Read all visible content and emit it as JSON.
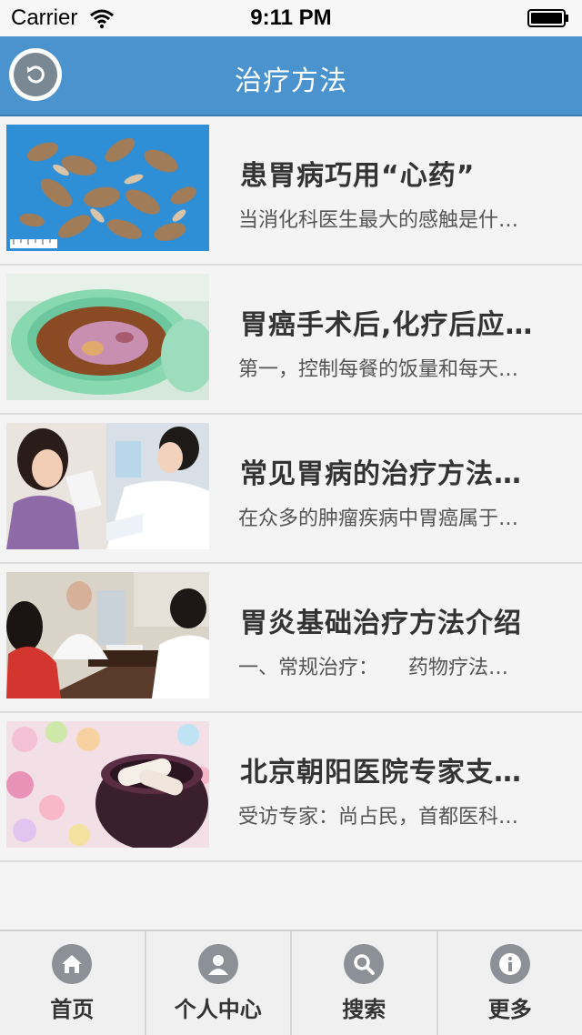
{
  "status_bar": {
    "carrier": "Carrier",
    "time": "9:11 PM"
  },
  "nav": {
    "title": "治疗方法",
    "accent_color": "#4a93cf"
  },
  "articles": [
    {
      "title": "患胃病巧用“心药”",
      "desc": "当消化科医生最大的感触是什…",
      "image": "dried-herbs-image"
    },
    {
      "title": "胃癌手术后,化疗后应…",
      "desc": "第一，控制每餐的饭量和每天…",
      "image": "tea-cup-image"
    },
    {
      "title": "常见胃病的治疗方法…",
      "desc": "在众多的肿瘤疾病中胃癌属于…",
      "image": "doctor-patient-image"
    },
    {
      "title": "胃炎基础治疗方法介绍",
      "desc": "一、常规治疗：　　药物疗法…",
      "image": "consultation-image"
    },
    {
      "title": "北京朝阳医院专家支…",
      "desc": "受访专家：尚占民，首都医科…",
      "image": "pills-jar-image"
    }
  ],
  "tabs": [
    {
      "label": "首页",
      "icon": "home-icon"
    },
    {
      "label": "个人中心",
      "icon": "user-icon"
    },
    {
      "label": "搜索",
      "icon": "search-icon"
    },
    {
      "label": "更多",
      "icon": "info-icon"
    }
  ]
}
